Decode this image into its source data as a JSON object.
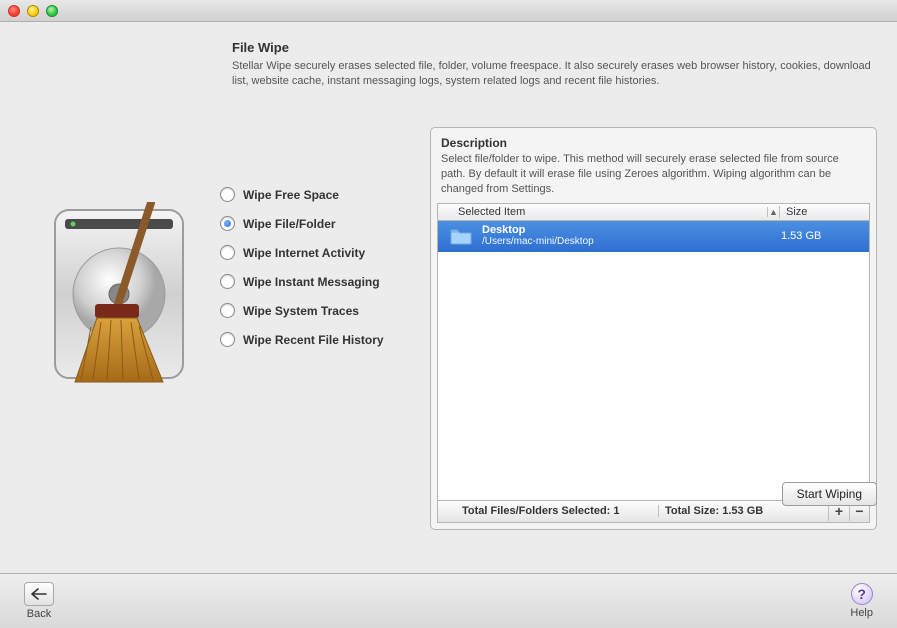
{
  "header": {
    "title": "File Wipe",
    "subtitle": "Stellar Wipe securely erases selected file, folder, volume freespace. It also securely erases web browser history, cookies, download list, website cache, instant messaging logs, system related logs and recent file histories."
  },
  "options": [
    {
      "label": "Wipe Free Space",
      "selected": false
    },
    {
      "label": "Wipe File/Folder",
      "selected": true
    },
    {
      "label": "Wipe Internet Activity",
      "selected": false
    },
    {
      "label": "Wipe Instant Messaging",
      "selected": false
    },
    {
      "label": "Wipe System Traces",
      "selected": false
    },
    {
      "label": "Wipe Recent File History",
      "selected": false
    }
  ],
  "panel": {
    "title": "Description",
    "description": "Select file/folder to wipe. This method will securely erase selected file from source path. By default it will erase file using Zeroes algorithm. Wiping algorithm can be changed from Settings.",
    "columns": {
      "item": "Selected Item",
      "size": "Size"
    },
    "rows": [
      {
        "name": "Desktop",
        "path": "/Users/mac-mini/Desktop",
        "size": "1.53 GB"
      }
    ],
    "footer": {
      "selected_label": "Total Files/Folders Selected: 1",
      "size_label": "Total Size: 1.53 GB",
      "add": "+",
      "remove": "−"
    }
  },
  "actions": {
    "start": "Start Wiping"
  },
  "toolbar": {
    "back": "Back",
    "help": "Help"
  }
}
